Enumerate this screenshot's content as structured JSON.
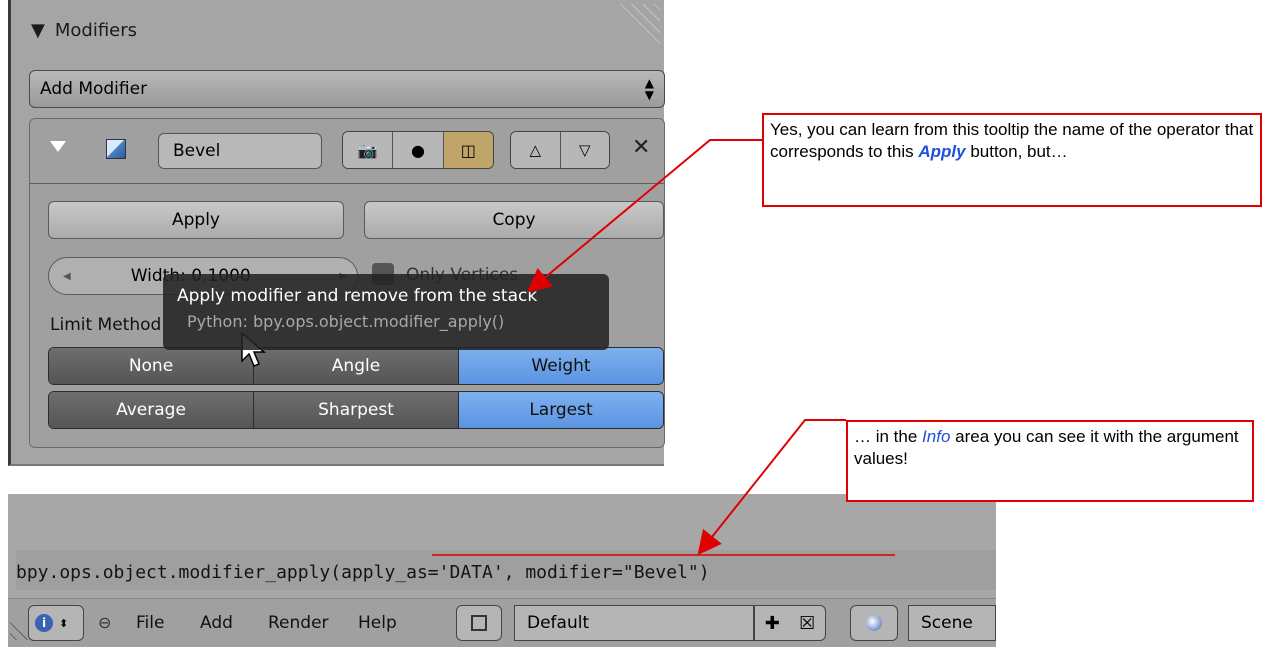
{
  "panel": {
    "title": "Modifiers",
    "add_modifier": "Add Modifier",
    "modifier": {
      "name": "Bevel",
      "apply_label": "Apply",
      "copy_label": "Copy",
      "width_field": "Width: 0.1000",
      "only_vertices": "Only Vertices",
      "limit_method_label": "Limit Method",
      "limit_methods": [
        "None",
        "Angle",
        "Weight"
      ],
      "limit_selected": "Weight",
      "angle_modes": [
        "Average",
        "Sharpest",
        "Largest"
      ],
      "angle_selected": "Largest"
    },
    "tooltip": {
      "description": "Apply modifier and remove from the stack",
      "python": "Python: bpy.ops.object.modifier_apply()"
    }
  },
  "info": {
    "report": "bpy.ops.object.modifier_apply(apply_as='DATA', modifier=\"Bevel\")",
    "menus": [
      "File",
      "Add",
      "Render",
      "Help"
    ],
    "layout": "Default",
    "scene": "Scene"
  },
  "callouts": {
    "c1": {
      "before": "Yes, you can learn from this tooltip the name of the operator that corresponds to this ",
      "highlight": "Apply",
      "after": " button, but…"
    },
    "c2": {
      "before": "… in the ",
      "highlight": "Info",
      "after": " area you can see it with the argument values!"
    }
  },
  "colors": {
    "callout_border": "#e00000",
    "accent_blue": "#1d4fe0",
    "active_toggle": "#6ea4ea"
  }
}
